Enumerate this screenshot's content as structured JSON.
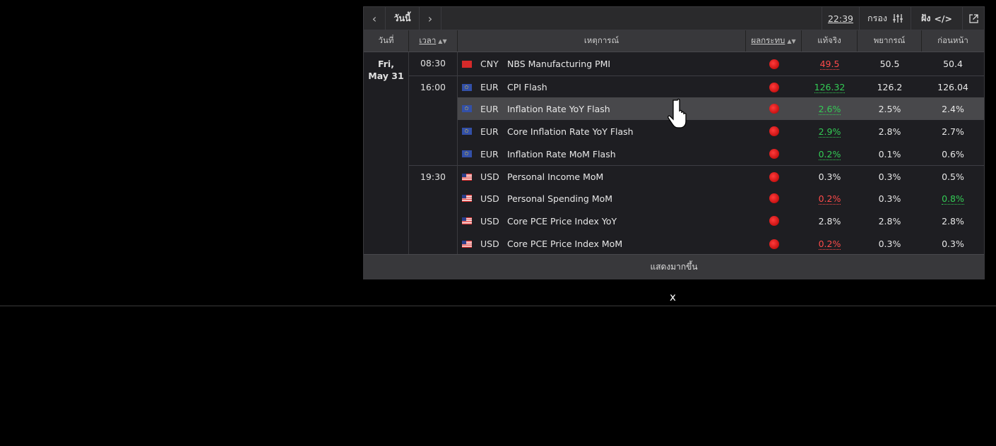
{
  "toolbar": {
    "prev_icon": "‹",
    "today_label": "วันนี้",
    "next_icon": "›",
    "time": "22:39",
    "filter_label": "กรอง",
    "embed_label": "ฝัง",
    "embed_code": "</>"
  },
  "header": {
    "date": "วันที่",
    "time": "เวลา",
    "event": "เหตุการณ์",
    "impact": "ผลกระทบ",
    "actual": "แท้จริง",
    "forecast": "พยากรณ์",
    "previous": "ก่อนหน้า"
  },
  "date_group": {
    "line1": "Fri,",
    "line2": "May 31"
  },
  "time_groups": [
    "08:30",
    "16:00",
    "19:30"
  ],
  "events": [
    {
      "currency": "CNY",
      "name": "NBS Manufacturing PMI",
      "actual": "49.5",
      "forecast": "50.5",
      "previous": "50.4",
      "actual_color": "red",
      "previous_color": ""
    },
    {
      "currency": "EUR",
      "name": "CPI Flash",
      "actual": "126.32",
      "forecast": "126.2",
      "previous": "126.04",
      "actual_color": "green",
      "previous_color": ""
    },
    {
      "currency": "EUR",
      "name": "Inflation Rate YoY Flash",
      "actual": "2.6%",
      "forecast": "2.5%",
      "previous": "2.4%",
      "actual_color": "green",
      "previous_color": ""
    },
    {
      "currency": "EUR",
      "name": "Core Inflation Rate YoY Flash",
      "actual": "2.9%",
      "forecast": "2.8%",
      "previous": "2.7%",
      "actual_color": "green",
      "previous_color": ""
    },
    {
      "currency": "EUR",
      "name": "Inflation Rate MoM Flash",
      "actual": "0.2%",
      "forecast": "0.1%",
      "previous": "0.6%",
      "actual_color": "green",
      "previous_color": ""
    },
    {
      "currency": "USD",
      "name": "Personal Income MoM",
      "actual": "0.3%",
      "forecast": "0.3%",
      "previous": "0.5%",
      "actual_color": "",
      "previous_color": ""
    },
    {
      "currency": "USD",
      "name": "Personal Spending MoM",
      "actual": "0.2%",
      "forecast": "0.3%",
      "previous": "0.8%",
      "actual_color": "red",
      "previous_color": "green"
    },
    {
      "currency": "USD",
      "name": "Core PCE Price Index YoY",
      "actual": "2.8%",
      "forecast": "2.8%",
      "previous": "2.8%",
      "actual_color": "",
      "previous_color": ""
    },
    {
      "currency": "USD",
      "name": "Core PCE Price Index MoM",
      "actual": "0.2%",
      "forecast": "0.3%",
      "previous": "0.3%",
      "actual_color": "red",
      "previous_color": ""
    }
  ],
  "footer": {
    "show_more": "แสดงมากขึ้น"
  },
  "overlay": {
    "close": "x"
  },
  "colors": {
    "positive": "#33cc55",
    "negative": "#ff4a4a",
    "impact_high": "#e01010"
  }
}
